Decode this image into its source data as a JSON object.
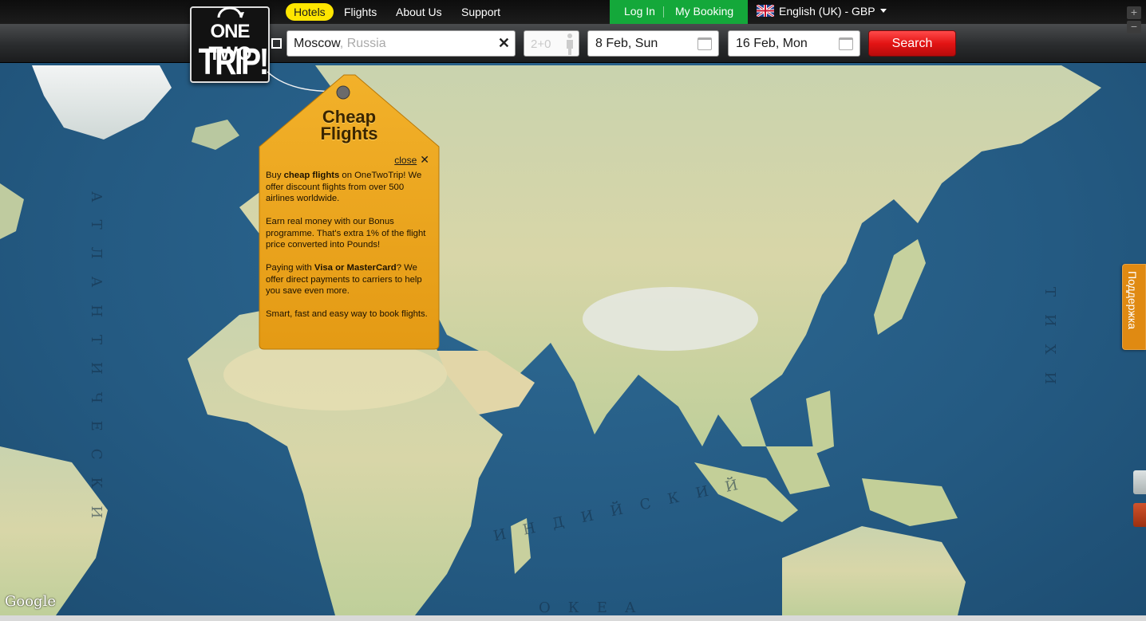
{
  "nav": {
    "hotels": "Hotels",
    "flights": "Flights",
    "about": "About Us",
    "support": "Support"
  },
  "auth": {
    "login": "Log In",
    "booking": "My Booking"
  },
  "language": "English (UK) - GBP",
  "logo": {
    "line1": "ONE TWO",
    "line2": "TRIP!"
  },
  "search": {
    "city": "Moscow",
    "city_hint": ", Russia",
    "passengers": "2+0",
    "date_from": "8 Feb, Sun",
    "date_to": "16 Feb, Mon",
    "button": "Search"
  },
  "tag": {
    "title_line1": "Cheap",
    "title_line2": "Flights",
    "close": "close",
    "p1_a": "Buy ",
    "p1_b": "cheap flights",
    "p1_c": " on OneTwoTrip! We offer discount flights from over 500 airlines worldwide.",
    "p2": "Earn real money with our Bonus programme. That's extra 1% of the flight price converted into Pounds!",
    "p3_a": "Paying with ",
    "p3_b": "Visa or MasterCard",
    "p3_c": "? We offer direct payments to carriers to help you save even more.",
    "p4": "Smart, fast and easy way to book flights."
  },
  "support_tab": "Поддержка",
  "map": {
    "google": "Google",
    "ocean_atlantic": "АТЛАНТИЧЕСКИ",
    "ocean_indian": "ИНДИЙСКИЙ",
    "ocean_pacific": "ТИХИ",
    "ocean_okea": "ОКЕА"
  },
  "colors": {
    "nav_active": "#ffe600",
    "auth": "#14a83a",
    "search_button": "#e31414",
    "tag": "#eaa21c",
    "support_tab": "#e08a12"
  }
}
